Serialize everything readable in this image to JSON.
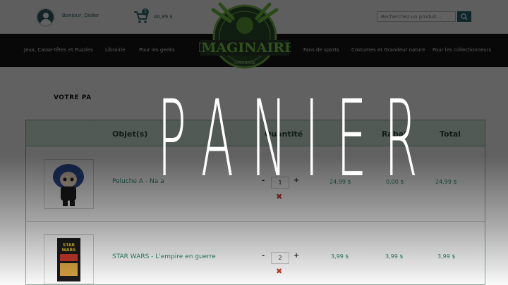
{
  "header": {
    "greeting": "Bonjour, Didier",
    "cart_count": "5",
    "cart_total": "40,89 $",
    "search_placeholder": "Recherchez un produit..."
  },
  "logo": {
    "text": "IMAGINAIRE",
    "ring_text": "IMAGINAIRE"
  },
  "nav": {
    "items": [
      "Jeux, Casse-têtes et Puzzles",
      "Librairie",
      "Pour les geeks",
      "Fans de sports",
      "Costumes et Grandeur nature",
      "Pour les collectionneurs"
    ]
  },
  "cart": {
    "heading": "VOTRE PA",
    "columns": [
      "Objet(s)",
      "Quantité",
      "Rabai",
      "Total"
    ],
    "rows": [
      {
        "name": "Peluche A    -  Na  a",
        "qty": "1",
        "price": "24,99 $",
        "discount": "0,00 $",
        "total": "24,99 $"
      },
      {
        "name": "STAR WARS - L'empire en guerre",
        "qty": "2",
        "price": "3,99 $",
        "discount": "3,99 $",
        "total": "3,99 $"
      }
    ],
    "minus": "-",
    "plus": "+",
    "remove": "✖"
  },
  "overlay_title": "PANIER",
  "colors": {
    "accent": "#26686c",
    "nav_bg": "#141414",
    "table_header": "#d6ebe0",
    "link": "#2e8b72",
    "remove": "#c0392b"
  }
}
